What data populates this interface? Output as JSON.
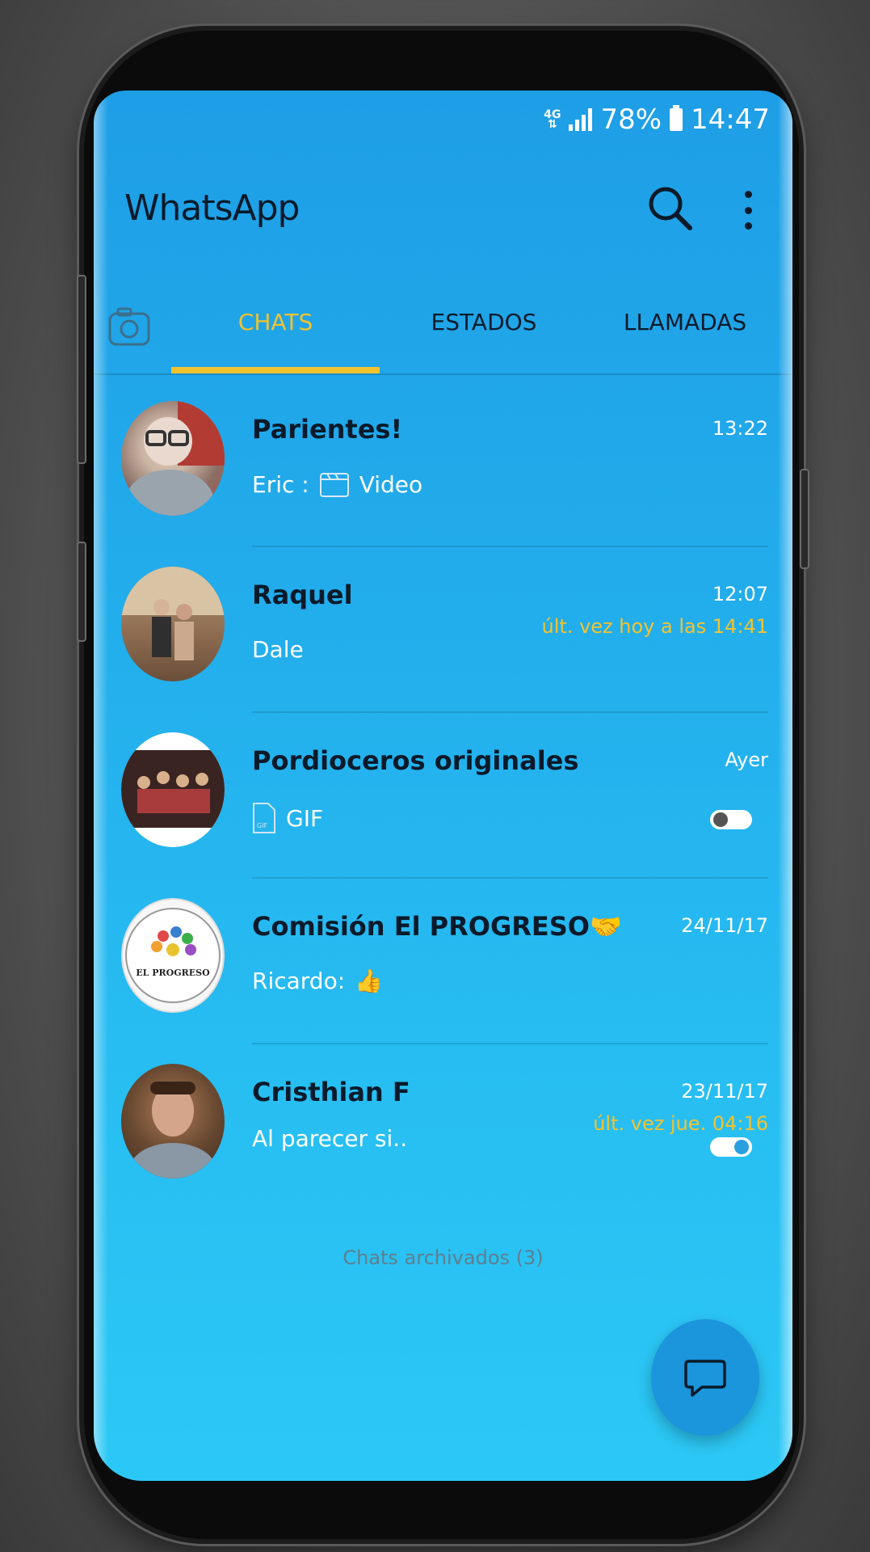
{
  "status_bar": {
    "network": "4G",
    "battery": "78%",
    "time": "14:47"
  },
  "header": {
    "title": "WhatsApp"
  },
  "tabs": [
    {
      "label": "CHATS",
      "active": true
    },
    {
      "label": "ESTADOS",
      "active": false
    },
    {
      "label": "LLAMADAS",
      "active": false
    }
  ],
  "chats": [
    {
      "name": "Parientes!",
      "time": "13:22",
      "sender": "Eric :",
      "message": "Video",
      "media": "video-icon",
      "last_seen": "",
      "toggle": null
    },
    {
      "name": "Raquel",
      "time": "12:07",
      "sender": "",
      "message": "Dale",
      "media": "",
      "last_seen": "últ. vez hoy a las 14:41",
      "toggle": null
    },
    {
      "name": "Pordioceros originales",
      "time": "Ayer",
      "sender": "",
      "message": "GIF",
      "media": "gif-icon",
      "last_seen": "",
      "toggle": "off"
    },
    {
      "name": "Comisión El PROGRESO🤝",
      "time": "24/11/17",
      "sender": "Ricardo:",
      "message": "👍",
      "media": "",
      "last_seen": "",
      "toggle": null
    },
    {
      "name": "Cristhian F",
      "time": "23/11/17",
      "sender": "",
      "message": "Al parecer si..",
      "media": "",
      "last_seen": "últ. vez jue. 04:16",
      "toggle": "on"
    }
  ],
  "archived": "Chats archivados (3)",
  "logo_text": {
    "line1": "EL PROGRESO"
  },
  "colors": {
    "accent": "#f2c32e",
    "background": "#22aceb",
    "fab": "#1b95dc"
  }
}
